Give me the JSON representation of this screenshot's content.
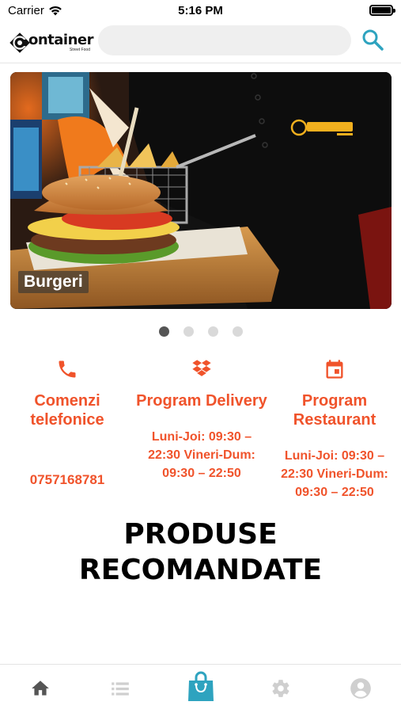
{
  "status": {
    "carrier": "Carrier",
    "time": "5:16 PM"
  },
  "header": {
    "logo_text": "ontainer",
    "logo_sub": "Street Food",
    "search_placeholder": ""
  },
  "banner": {
    "caption": "Burgeri",
    "slide_count": 4,
    "active_slide": 1
  },
  "info": {
    "phone": {
      "title": "Comenzi telefonice",
      "value": "0757168781",
      "icon": "phone-icon"
    },
    "delivery": {
      "title": "Program Delivery",
      "hours": "Luni-Joi: 09:30 – 22:30 Vineri-Dum: 09:30 – 22:50",
      "icon": "dropbox-icon"
    },
    "restaurant": {
      "title": "Program Restaurant",
      "hours": "Luni-Joi: 09:30 – 22:30 Vineri-Dum: 09:30 – 22:50",
      "icon": "calendar-icon"
    }
  },
  "section": {
    "title": "PRODUSE RECOMANDATE"
  },
  "tabs": [
    {
      "name": "home",
      "icon": "home-icon",
      "active": false
    },
    {
      "name": "list",
      "icon": "list-icon",
      "active": false
    },
    {
      "name": "cart",
      "icon": "shopping-bag-icon",
      "active": true
    },
    {
      "name": "settings",
      "icon": "gear-icon",
      "active": false
    },
    {
      "name": "profile",
      "icon": "user-icon",
      "active": false
    }
  ],
  "colors": {
    "accent": "#f0532b",
    "tab_active": "#2ea3bf",
    "tab_inactive": "#cfcfcf",
    "tab_home": "#555555",
    "search_icon": "#2ea3bf"
  }
}
